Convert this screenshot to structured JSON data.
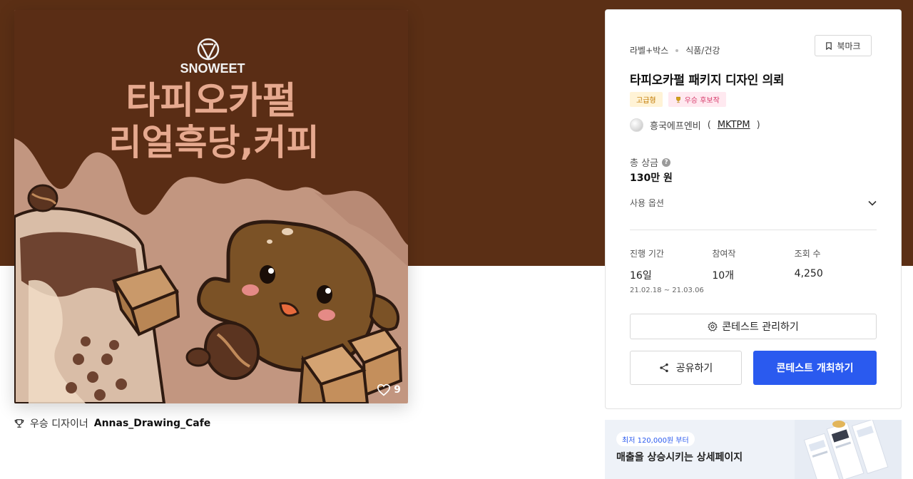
{
  "artwork": {
    "brand": "SNOWEET",
    "headline1": "타피오카펄",
    "headline2": "리얼흑당,커피",
    "likes": "9"
  },
  "winner": {
    "prefix": "우승 디자이너",
    "name": "Annas_Drawing_Cafe"
  },
  "panel": {
    "category1": "라벨+박스",
    "category2": "식품/건강",
    "bookmark_label": "북마크",
    "title": "타피오카펄 패키지 디자인 의뢰",
    "badge_grade": "고급형",
    "badge_winner": "우승 후보작",
    "host_name": "흥국에프엔비",
    "host_id_open": "(",
    "host_id": "MKTPM",
    "host_id_close": ")",
    "prize_label": "총 상금",
    "prize_value": "130만 원",
    "options_label": "사용 옵션",
    "stats": [
      {
        "label": "진행 기간",
        "value": "16일",
        "sub": "21.02.18 ~ 21.03.06"
      },
      {
        "label": "참여작",
        "value": "10개",
        "sub": ""
      },
      {
        "label": "조회 수",
        "value": "4,250",
        "sub": ""
      }
    ],
    "manage_label": "콘테스트 관리하기",
    "share_label": "공유하기",
    "host_contest_label": "콘테스트 개최하기"
  },
  "ad": {
    "chip": "최저 120,000원 부터",
    "title": "매출을 상승시키는 상세페이지"
  },
  "colors": {
    "hero_bg": "#5b2f15",
    "primary": "#2a5aef",
    "badge_grade": "#c07800",
    "badge_winner": "#d63a6a"
  }
}
